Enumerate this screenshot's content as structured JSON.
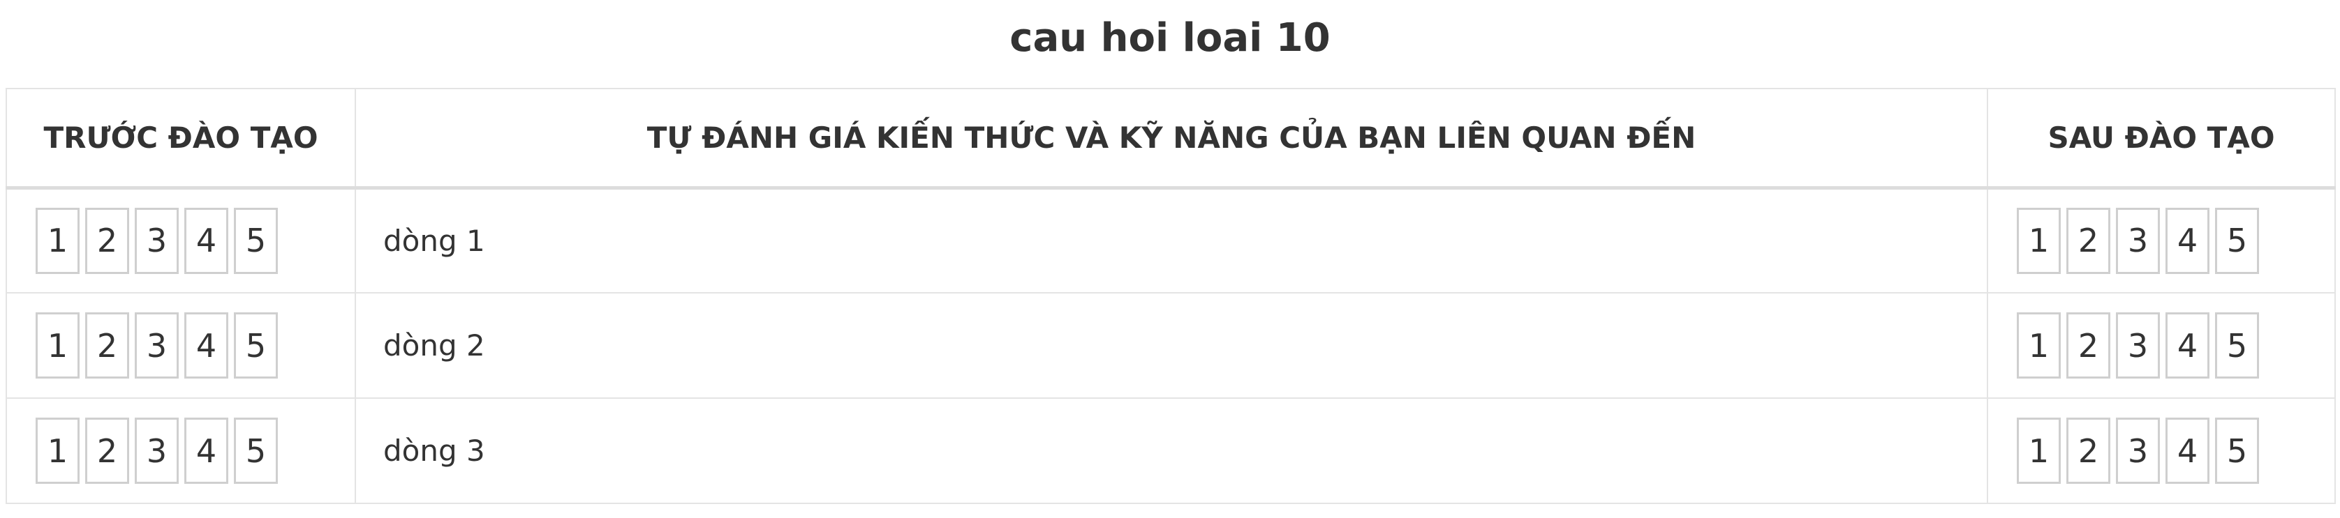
{
  "title": "cau hoi loai 10",
  "table": {
    "headers": {
      "before": "TRƯỚC ĐÀO TẠO",
      "middle": "TỰ ĐÁNH GIÁ KIẾN THỨC VÀ KỸ NĂNG CỦA BẠN LIÊN QUAN ĐẾN",
      "after": "SAU ĐÀO TẠO"
    },
    "scale": [
      "1",
      "2",
      "3",
      "4",
      "5"
    ],
    "rows": [
      {
        "label": "dòng 1"
      },
      {
        "label": "dòng 2"
      },
      {
        "label": "dòng 3"
      }
    ]
  }
}
